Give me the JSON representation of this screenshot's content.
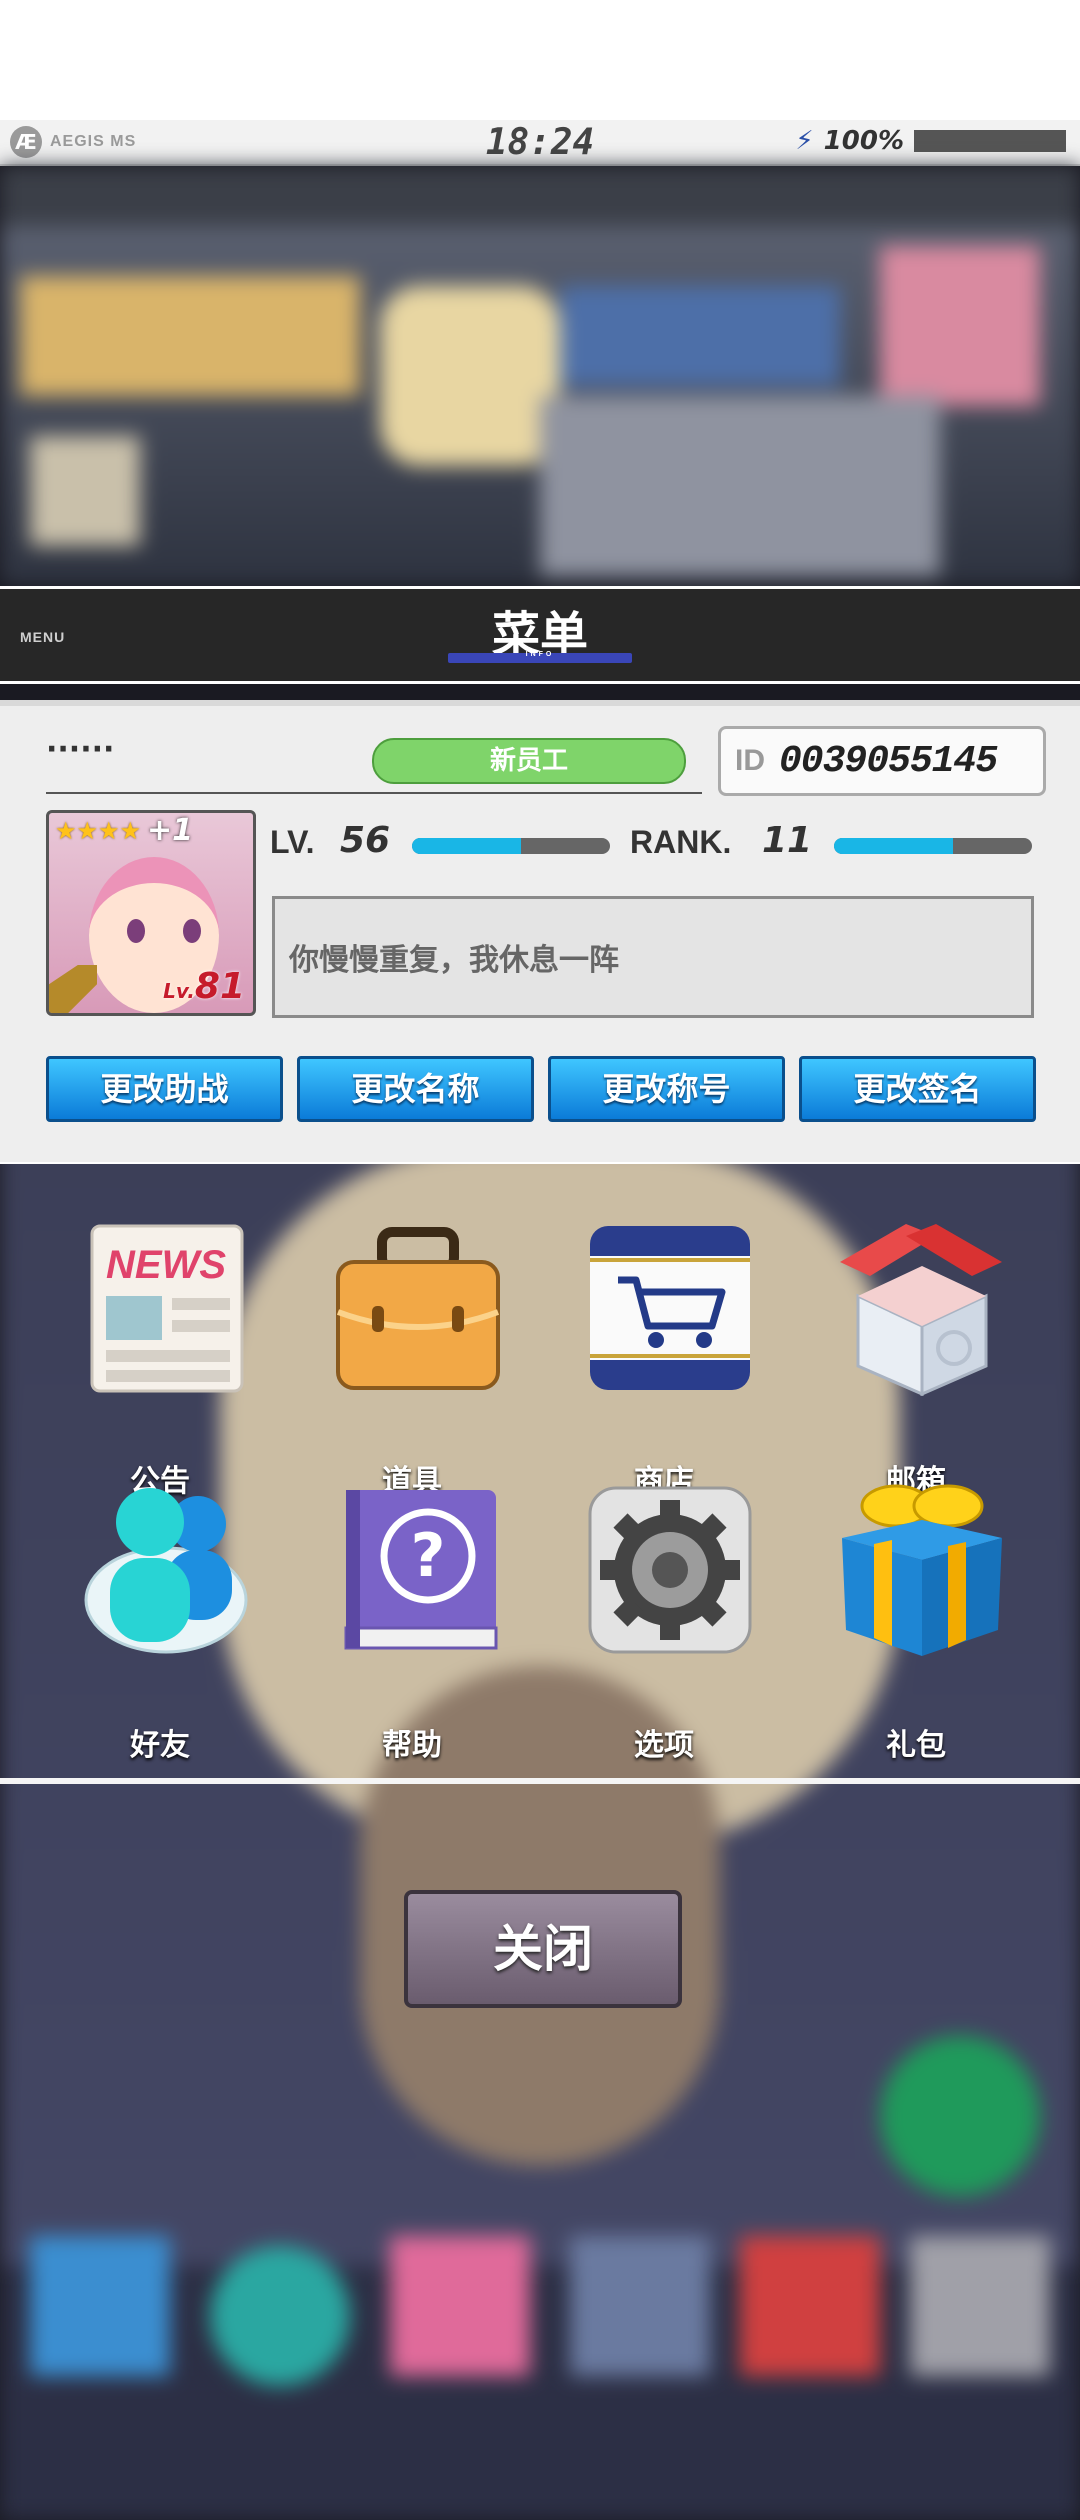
{
  "status_bar": {
    "brand": "AEGIS MS",
    "time": "18:24",
    "battery_percent": "100%",
    "battery_level": 1.0
  },
  "menu": {
    "left_label": "MENU",
    "title": "菜单",
    "subtitle": "INFO"
  },
  "profile": {
    "name": "······",
    "title_badge": "新员工",
    "id_label": "ID",
    "id_value": "0039055145",
    "avatar": {
      "stars": "★★★★",
      "plus": "+1",
      "level_prefix": "Lv.",
      "level": "81"
    },
    "lv_label": "LV.",
    "lv_value": "56",
    "lv_progress": 0.55,
    "rank_label": "RANK.",
    "rank_value": "11",
    "rank_progress": 0.6,
    "signature": "你慢慢重复，我休息一阵",
    "buttons": [
      "更改助战",
      "更改名称",
      "更改称号",
      "更改签名"
    ]
  },
  "icons": [
    {
      "label": "公告",
      "icon": "news-icon",
      "art_text": "NEWS"
    },
    {
      "label": "道具",
      "icon": "briefcase-icon"
    },
    {
      "label": "商店",
      "icon": "cart-icon"
    },
    {
      "label": "邮箱",
      "icon": "mailbox-icon"
    },
    {
      "label": "好友",
      "icon": "friends-icon"
    },
    {
      "label": "帮助",
      "icon": "help-book-icon",
      "art_text": "?"
    },
    {
      "label": "选项",
      "icon": "gear-icon"
    },
    {
      "label": "礼包",
      "icon": "gift-icon"
    }
  ],
  "close_button": "关闭",
  "colors": {
    "accent_blue": "#19b6e6",
    "button_blue": "#0b7bd8",
    "title_green": "#7fd46a",
    "menu_bar": "#272727"
  }
}
